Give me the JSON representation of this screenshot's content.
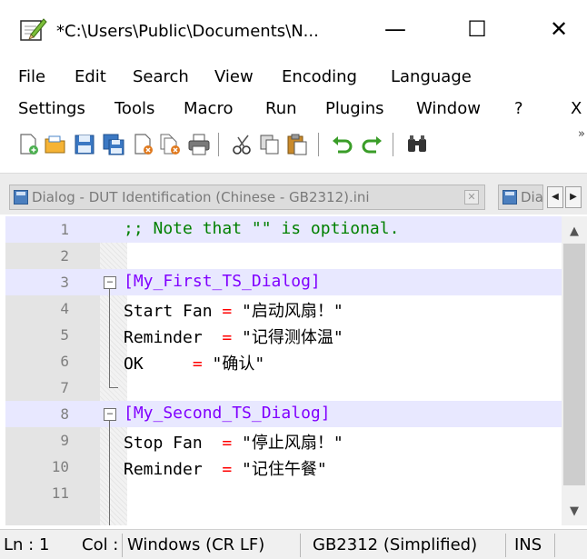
{
  "window": {
    "title": "*C:\\Users\\Public\\Documents\\N...",
    "min_glyph": "—",
    "max_glyph": "☐",
    "close_glyph": "✕"
  },
  "menus": {
    "row1": [
      "File",
      "Edit",
      "Search",
      "View",
      "Encoding",
      "Language"
    ],
    "row2": [
      "Settings",
      "Tools",
      "Macro",
      "Run",
      "Plugins",
      "Window",
      "?"
    ],
    "row2_close": "X"
  },
  "toolbar": {
    "icons": [
      "new-file-icon",
      "open-file-icon",
      "save-icon",
      "save-all-icon",
      "close-icon",
      "close-all-icon",
      "print-icon",
      "cut-icon",
      "copy-icon",
      "paste-icon",
      "undo-icon",
      "redo-icon",
      "find-icon"
    ],
    "more_glyph": "»"
  },
  "tabs": [
    {
      "label": "Dialog - DUT Identification (Chinese - GB2312).ini",
      "close_glyph": "✕"
    },
    {
      "label": "Dia"
    }
  ],
  "tab_nav": {
    "left": "◀",
    "right": "▶"
  },
  "editor": {
    "lines": [
      {
        "n": "1",
        "text": ";; Note that \"\" is optional."
      },
      {
        "n": "2",
        "text": ""
      },
      {
        "n": "3",
        "text": "[My_First_TS_Dialog]"
      },
      {
        "n": "4",
        "key": "Start Fan ",
        "op": "=",
        "val": " \"启动风扇！\""
      },
      {
        "n": "5",
        "key": "Reminder  ",
        "op": "=",
        "val": " \"记得测体温\""
      },
      {
        "n": "6",
        "key": "OK     ",
        "op": "=",
        "val": " \"确认\""
      },
      {
        "n": "7",
        "text": ""
      },
      {
        "n": "8",
        "text": "[My_Second_TS_Dialog]"
      },
      {
        "n": "9",
        "key": "Stop Fan  ",
        "op": "=",
        "val": " \"停止风扇！\""
      },
      {
        "n": "10",
        "key": "Reminder  ",
        "op": "=",
        "val": " \"记住午餐\""
      },
      {
        "n": "11",
        "text": ""
      }
    ],
    "fold_glyph": "−"
  },
  "scrollbar": {
    "up": "▲",
    "down": "▼"
  },
  "status": {
    "ln": "Ln : 1",
    "col": "Col :",
    "eol": "Windows (CR LF)",
    "encoding": "GB2312 (Simplified)",
    "mode": "INS"
  }
}
